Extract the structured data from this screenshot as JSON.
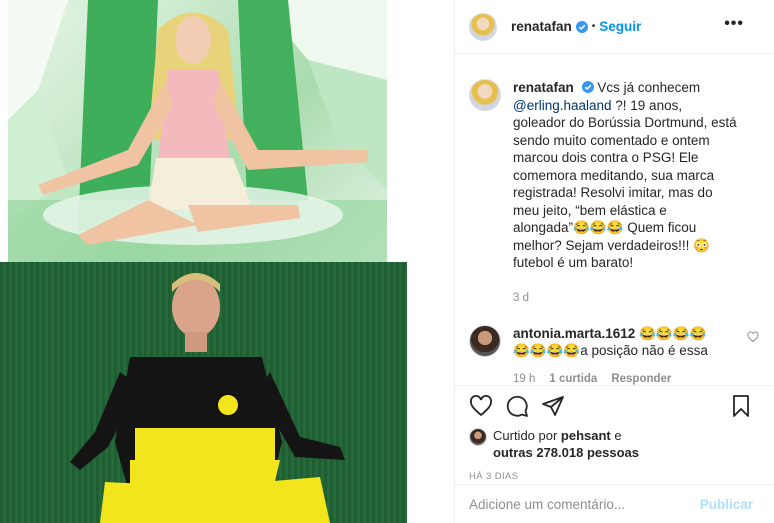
{
  "post": {
    "username": "renatafan",
    "follow_label": "Seguir",
    "dot": "•",
    "more_label": "•••"
  },
  "caption": {
    "username": "renatafan",
    "text_1": "Vcs já conhecem ",
    "mention": "@erling.haaland",
    "text_2": " ?! 19 anos, goleador do Borússia Dortmund, está sendo muito comentado e ontem marcou dois contra o PSG! Ele comemora meditando, sua marca registrada! Resolvi imitar, mas do meu jeito, “bem elástica e alongada”😂😂😂 Quem ficou melhor? Sejam verdadeiros!!! 😳 futebol é um barato!",
    "time": "3 d"
  },
  "comment": {
    "username": "antonia.marta.1612",
    "text": " 😂😂😂😂😂😂😂😂a posição não é essa",
    "time": "19 h",
    "likes": "1 curtida",
    "reply_label": "Responder"
  },
  "likes": {
    "prefix": "Curtido por ",
    "user": "pehsant",
    "mid": " e ",
    "others": "outras 278.018 pessoas"
  },
  "post_time": "HÁ 3 DIAS",
  "add_comment": {
    "placeholder": "Adicione um comentário...",
    "publish_label": "Publicar"
  },
  "colors": {
    "link_blue": "#0095f6",
    "publish_disabled": "#b2dffc",
    "secondary_text": "#8e8e8e",
    "verified_blue": "#3897f0"
  },
  "icons": [
    "verified-badge-icon",
    "more-options-icon",
    "heart-icon",
    "comment-icon",
    "share-icon",
    "bookmark-icon"
  ]
}
